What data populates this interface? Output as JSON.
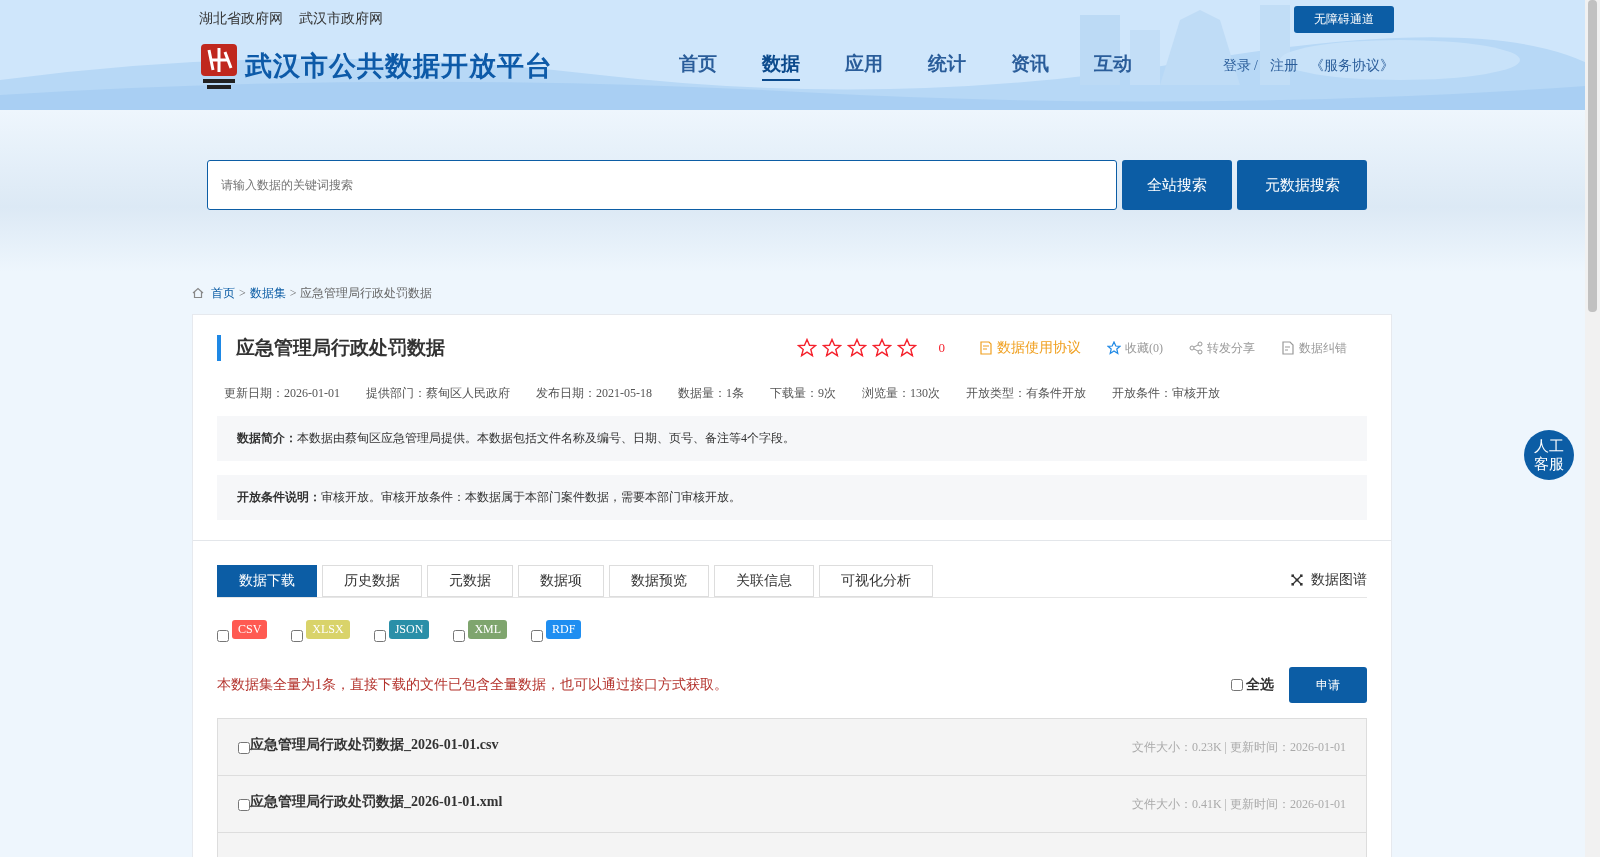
{
  "top_links": [
    "湖北省政府网",
    "武汉市政府网"
  ],
  "accessibility_button": "无障碍通道",
  "site_title": "武汉市公共数据开放平台",
  "nav": [
    {
      "label": "首页",
      "selected": false
    },
    {
      "label": "数据",
      "selected": true
    },
    {
      "label": "应用",
      "selected": false
    },
    {
      "label": "统计",
      "selected": false
    },
    {
      "label": "资讯",
      "selected": false
    },
    {
      "label": "互动",
      "selected": false
    }
  ],
  "user_links": {
    "login": "登录 /",
    "register": "注册",
    "agreement": "《服务协议》"
  },
  "search": {
    "placeholder": "请输入数据的关键词搜索",
    "buttons": [
      "全站搜索",
      "元数据搜索"
    ]
  },
  "breadcrumb": [
    {
      "label": "首页",
      "link": true
    },
    {
      "label": ">",
      "link": false
    },
    {
      "label": "数据集",
      "link": true
    },
    {
      "label": "> 应急管理局行政处罚数据",
      "link": false
    }
  ],
  "dataset": {
    "title": "应急管理局行政处罚数据",
    "stars": 0,
    "rating": "0",
    "actions": [
      {
        "kind": "agreement",
        "label": "数据使用协议"
      },
      {
        "kind": "favorite",
        "label": "收藏(0)"
      },
      {
        "kind": "share",
        "label": "转发分享"
      },
      {
        "kind": "report",
        "label": "数据纠错"
      }
    ],
    "meta": [
      "更新日期：2026-01-01",
      "提供部门：蔡甸区人民政府",
      "发布日期：2021-05-18",
      "数据量：1条",
      "下载量：9次",
      "浏览量：130次",
      "开放类型：有条件开放",
      "开放条件：审核开放"
    ],
    "notes": [
      {
        "label": "数据简介：",
        "text": "本数据由蔡甸区应急管理局提供。本数据包括文件名称及编号、日期、页号、备注等4个字段。"
      },
      {
        "label": "开放条件说明：",
        "text": "审核开放。审核开放条件：本数据属于本部门案件数据，需要本部门审核开放。"
      }
    ]
  },
  "tabs": [
    {
      "label": "数据下载",
      "selected": true
    },
    {
      "label": "历史数据",
      "selected": false
    },
    {
      "label": "元数据",
      "selected": false
    },
    {
      "label": "数据项",
      "selected": false
    },
    {
      "label": "数据预览",
      "selected": false
    },
    {
      "label": "关联信息",
      "selected": false
    },
    {
      "label": "可视化分析",
      "selected": false
    }
  ],
  "graph_link": "数据图谱",
  "formats": [
    {
      "label": "CSV",
      "checked": false,
      "color": "#ff5a52"
    },
    {
      "label": "XLSX",
      "checked": false,
      "color": "#d9d36a"
    },
    {
      "label": "JSON",
      "checked": false,
      "color": "#2a8fa8"
    },
    {
      "label": "XML",
      "checked": false,
      "color": "#7fa56e"
    },
    {
      "label": "RDF",
      "checked": false,
      "color": "#1f8ef1"
    }
  ],
  "notice": "本数据集全量为1条，直接下载的文件已包含全量数据，也可以通过接口方式获取。",
  "select_all": {
    "label": "全选",
    "checked": false
  },
  "apply_button": "申请",
  "files": [
    {
      "name": "应急管理局行政处罚数据_2026-01-01.csv",
      "info": "文件大小：0.23K | 更新时间：2026-01-01",
      "checked": false
    },
    {
      "name": "应急管理局行政处罚数据_2026-01-01.xml",
      "info": "文件大小：0.41K | 更新时间：2026-01-01",
      "checked": false
    }
  ],
  "service_button": "人工客服"
}
